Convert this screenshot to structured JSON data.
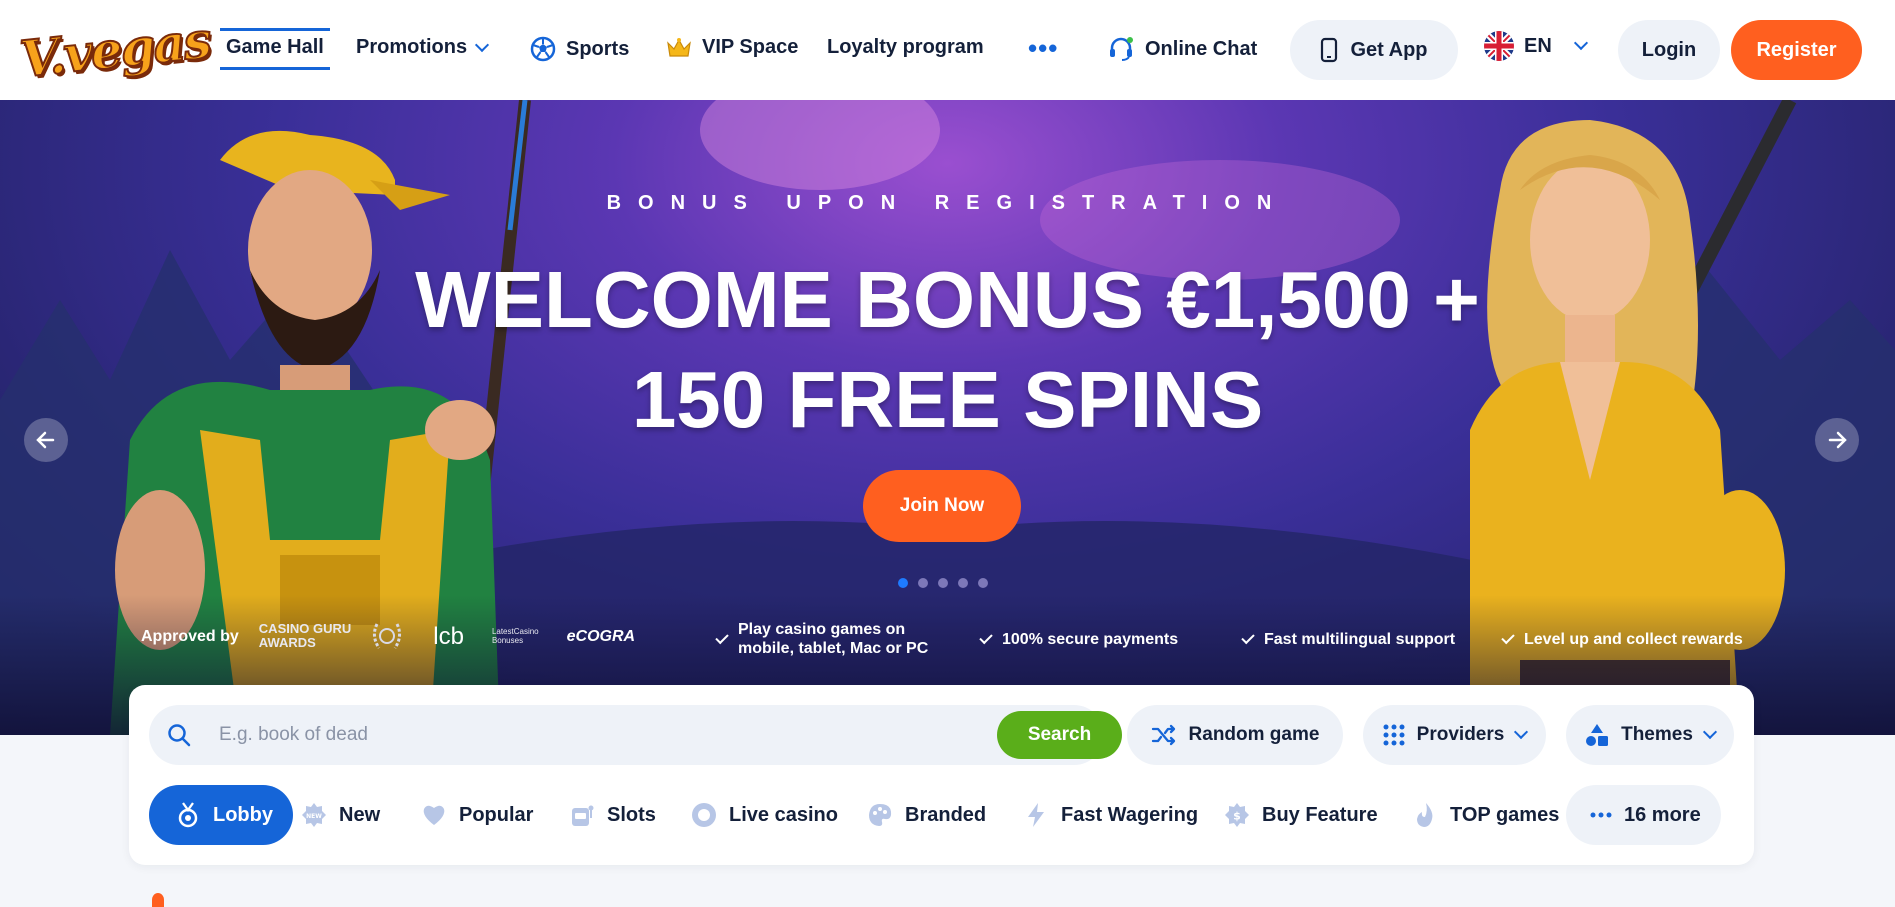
{
  "header": {
    "logo_text": "V.vegas",
    "nav": {
      "game_hall": "Game Hall",
      "promotions": "Promotions",
      "sports": "Sports",
      "vip_space": "VIP Space",
      "loyalty_program": "Loyalty program",
      "more": "•••",
      "online_chat": "Online Chat"
    },
    "get_app": "Get App",
    "language": "EN",
    "login": "Login",
    "register": "Register"
  },
  "hero": {
    "eyebrow": "BONUS UPON REGISTRATION",
    "headline_line1": "WELCOME BONUS €1,500 +",
    "headline_line2": "150 FREE SPINS",
    "cta": "Join Now",
    "slides_total": 5,
    "active_slide": 1,
    "approved_by": "Approved by",
    "awards": {
      "casino_guru_line1": "CASINO GURU",
      "casino_guru_line2": "AWARDS",
      "lcb": "lcb",
      "latest_casino_line1": "LatestCasino",
      "latest_casino_line2": "Bonuses",
      "ecogra": "eCOGRA"
    },
    "features": {
      "f1_line1": "Play casino games on",
      "f1_line2": "mobile, tablet, Mac or PC",
      "f2": "100% secure payments",
      "f3": "Fast multilingual support",
      "f4": "Level up and collect rewards"
    }
  },
  "search": {
    "placeholder": "E.g. book of dead",
    "button": "Search",
    "random_game": "Random game",
    "providers": "Providers",
    "themes": "Themes"
  },
  "categories": {
    "lobby": "Lobby",
    "new": "New",
    "popular": "Popular",
    "slots": "Slots",
    "live_casino": "Live casino",
    "branded": "Branded",
    "fast_wagering": "Fast Wagering",
    "buy_feature": "Buy Feature",
    "top_games": "TOP games",
    "more": "16 more"
  },
  "colors": {
    "accent_blue": "#1565d8",
    "cta_orange": "#ff5f1f",
    "search_green": "#5aae1a",
    "header_bg": "#ffffff",
    "hero_bg": "#3a2f98"
  }
}
